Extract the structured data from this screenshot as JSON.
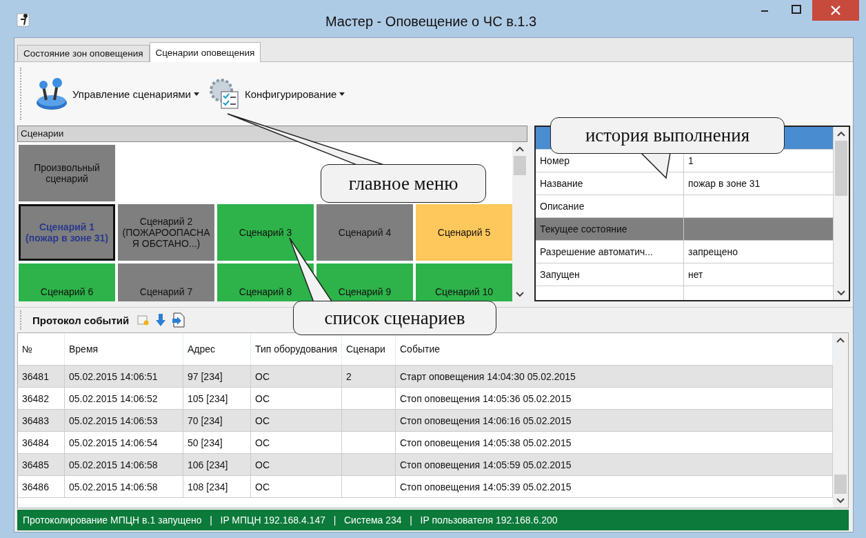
{
  "window": {
    "title": "Мастер - Оповещение о ЧС в.1.3"
  },
  "tabs": [
    {
      "label": "Состояние зон оповещения",
      "selected": false
    },
    {
      "label": "Сценарии оповещения",
      "selected": true
    }
  ],
  "toolbar": {
    "menus": [
      {
        "label": "Управление сценариями",
        "kind": "joystick"
      },
      {
        "label": "Конфигурирование",
        "kind": "config"
      }
    ]
  },
  "scenarios": {
    "title": "Сценарии",
    "rows": [
      [
        {
          "label": "Произвольный сценарий",
          "color": "#7f7f7f",
          "selected": false
        }
      ],
      [
        {
          "label": "Сценарий 1 (пожар в зоне 31)",
          "color": "#7f7f7f",
          "selected": true
        },
        {
          "label": "Сценарий 2 (ПОЖАРООПАСНАЯ ОБСТАНО...)",
          "color": "#7f7f7f",
          "selected": false
        },
        {
          "label": "Сценарий 3",
          "color": "#2db34a",
          "selected": false
        },
        {
          "label": "Сценарий 4",
          "color": "#7f7f7f",
          "selected": false
        },
        {
          "label": "Сценарий 5",
          "color": "#ffc85c",
          "selected": false
        }
      ],
      [
        {
          "label": "Сценарий 6",
          "color": "#2db34a",
          "selected": false
        },
        {
          "label": "Сценарий 7",
          "color": "#7f7f7f",
          "selected": false
        },
        {
          "label": "Сценарий 8",
          "color": "#2db34a",
          "selected": false
        },
        {
          "label": "Сценарий 9",
          "color": "#2db34a",
          "selected": false
        },
        {
          "label": "Сценарий 10",
          "color": "#2db34a",
          "selected": false
        }
      ]
    ]
  },
  "properties": {
    "rows": [
      {
        "kind": "header"
      },
      {
        "kind": "property",
        "name": "Номер",
        "value": "1"
      },
      {
        "kind": "property",
        "name": "Название",
        "value": "пожар в зоне 31"
      },
      {
        "kind": "property",
        "name": "Описание"
      },
      {
        "kind": "category",
        "name": "Текущее состояние"
      },
      {
        "kind": "property",
        "name": "Разрешение автоматич...",
        "value": "запрещено"
      },
      {
        "kind": "property",
        "name": "Запущен",
        "value": "нет"
      }
    ]
  },
  "event_log": {
    "title": "Протокол событий",
    "columns": [
      "№",
      "Время",
      "Адрес",
      "Тип оборудования",
      "Сценари",
      "Событие"
    ],
    "rows": [
      {
        "number": "36481",
        "time": "05.02.2015 14:06:51",
        "address": "97 [234]",
        "equipment_type": "ОС",
        "scenario": "2",
        "event": "Старт оповещения 14:04:30 05.02.2015"
      },
      {
        "number": "36482",
        "time": "05.02.2015 14:06:52",
        "address": "105 [234]",
        "equipment_type": "ОС",
        "event": "Стоп оповещения 14:05:36 05.02.2015"
      },
      {
        "number": "36483",
        "time": "05.02.2015 14:06:53",
        "address": "70 [234]",
        "equipment_type": "ОС",
        "event": "Стоп оповещения 14:06:16 05.02.2015"
      },
      {
        "number": "36484",
        "time": "05.02.2015 14:06:54",
        "address": "50 [234]",
        "equipment_type": "ОС",
        "event": "Стоп оповещения 14:05:38 05.02.2015"
      },
      {
        "number": "36485",
        "time": "05.02.2015 14:06:58",
        "address": "106 [234]",
        "equipment_type": "ОС",
        "event": "Стоп оповещения 14:05:59 05.02.2015"
      },
      {
        "number": "36486",
        "time": "05.02.2015 14:06:58",
        "address": "108 [234]",
        "equipment_type": "ОС",
        "event": "Стоп оповещения 14:05:39 05.02.2015"
      }
    ]
  },
  "status_bar": {
    "text": "Протоколирование МПЦН в.1 запущено   |   IP МПЦН 192.168.4.147   |   Система 234   |   IP пользователя 192.168.6.200"
  },
  "callouts": [
    {
      "text": "главное меню"
    },
    {
      "text": "история выполнения"
    },
    {
      "text": "список сценариев"
    }
  ]
}
